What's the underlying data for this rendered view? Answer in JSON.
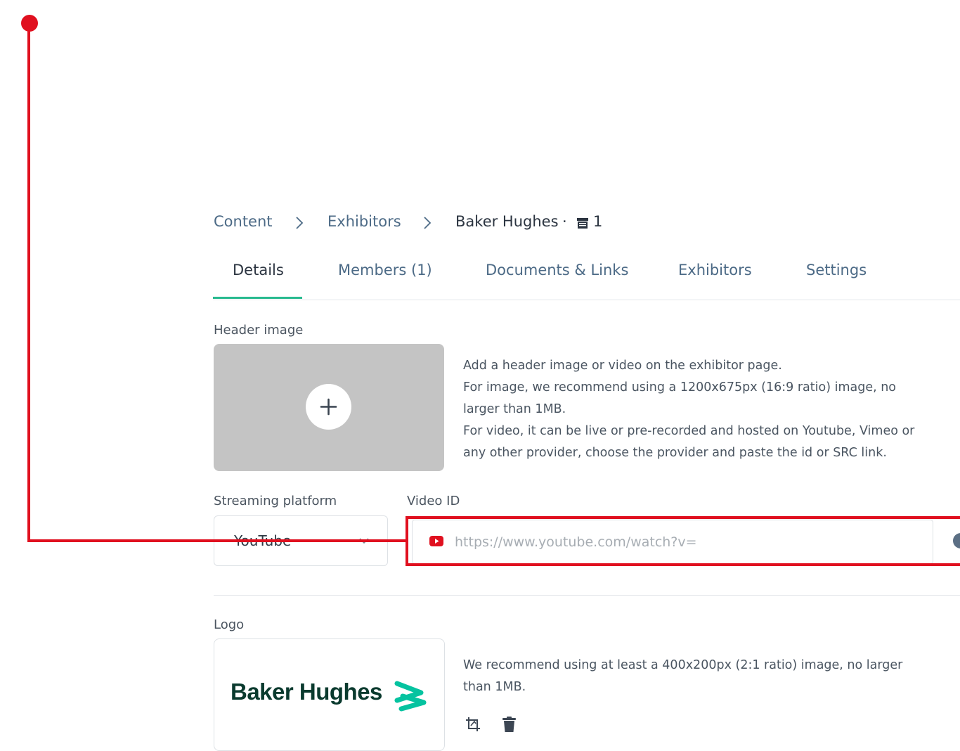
{
  "breadcrumb": {
    "items": [
      "Content",
      "Exhibitors"
    ],
    "current": "Baker Hughes",
    "separator": "·",
    "booth_icon": "booth-icon",
    "booth_number": "1"
  },
  "tabs": [
    {
      "label": "Details",
      "active": true
    },
    {
      "label": "Members (1)",
      "active": false
    },
    {
      "label": "Documents & Links",
      "active": false
    },
    {
      "label": "Exhibitors",
      "active": false
    },
    {
      "label": "Settings",
      "active": false
    }
  ],
  "header_image": {
    "label": "Header image",
    "add_icon": "plus-icon",
    "info": [
      "Add a header image or video on the exhibitor page.",
      "For image, we recommend using a 1200x675px (16:9 ratio) image, no",
      "larger than 1MB.",
      "For video, it can be live or pre-recorded and hosted on Youtube, Vimeo or",
      "any other provider, choose the provider and paste the id or SRC link."
    ]
  },
  "streaming": {
    "label": "Streaming platform",
    "value": "YouTube"
  },
  "video": {
    "label": "Video ID",
    "placeholder": "https://www.youtube.com/watch?v=",
    "value": "",
    "icon": "youtube-icon"
  },
  "logo": {
    "label": "Logo",
    "brand_text": "Baker Hughes",
    "info": [
      "We recommend using at least a 400x200px (2:1 ratio) image, no larger",
      "than 1MB."
    ],
    "actions": [
      "crop-icon",
      "trash-icon"
    ]
  },
  "colors": {
    "accent": "#27ba8f",
    "annotation": "#e0101f",
    "link": "#4c6a86",
    "brand": "#0a3a2e"
  }
}
